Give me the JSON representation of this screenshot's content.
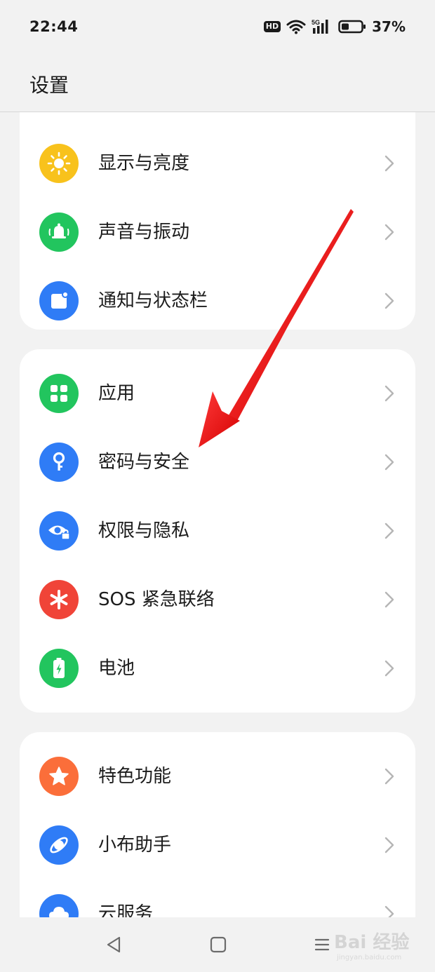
{
  "status_bar": {
    "time": "22:44",
    "hd_label": "HD",
    "network_label": "5G",
    "battery_percent": "37%",
    "battery_level": 0.37
  },
  "header": {
    "title": "设置"
  },
  "groups": [
    {
      "items": [
        {
          "label": "显示与亮度",
          "icon": "sun-icon",
          "color": "#f8c21c"
        },
        {
          "label": "声音与振动",
          "icon": "bell-icon",
          "color": "#22c55e"
        },
        {
          "label": "通知与状态栏",
          "icon": "notification-icon",
          "color": "#2f7cf6"
        }
      ]
    },
    {
      "items": [
        {
          "label": "应用",
          "icon": "apps-grid-icon",
          "color": "#22c55e"
        },
        {
          "label": "密码与安全",
          "icon": "key-icon",
          "color": "#2f7cf6"
        },
        {
          "label": "权限与隐私",
          "icon": "privacy-eye-lock-icon",
          "color": "#2f7cf6"
        },
        {
          "label": "SOS 紧急联络",
          "icon": "asterisk-icon",
          "color": "#f04438"
        },
        {
          "label": "电池",
          "icon": "battery-icon",
          "color": "#22c55e"
        }
      ]
    },
    {
      "items": [
        {
          "label": "特色功能",
          "icon": "star-icon",
          "color": "#fb6e3a"
        },
        {
          "label": "小布助手",
          "icon": "assistant-orbit-icon",
          "color": "#2f7cf6"
        },
        {
          "label": "云服务",
          "icon": "cloud-icon",
          "color": "#2f7cf6"
        }
      ]
    }
  ],
  "watermark": {
    "text": "Bai 经验",
    "sub": "jingyan.baidu.com"
  }
}
